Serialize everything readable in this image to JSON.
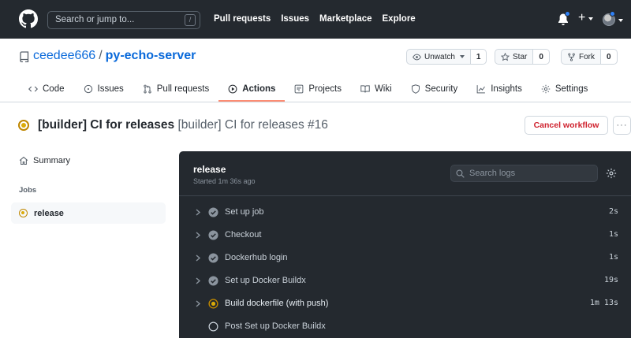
{
  "header": {
    "search_placeholder": "Search or jump to...",
    "search_shortcut": "/",
    "nav": [
      "Pull requests",
      "Issues",
      "Marketplace",
      "Explore"
    ],
    "plus": "+"
  },
  "repo": {
    "owner": "ceedee666",
    "separator": "/",
    "name": "py-echo-server",
    "actions": {
      "watch": {
        "label": "Unwatch",
        "count": "1"
      },
      "star": {
        "label": "Star",
        "count": "0"
      },
      "fork": {
        "label": "Fork",
        "count": "0"
      }
    }
  },
  "tabs": [
    {
      "label": "Code",
      "icon": "code-icon"
    },
    {
      "label": "Issues",
      "icon": "issue-icon"
    },
    {
      "label": "Pull requests",
      "icon": "pull-request-icon"
    },
    {
      "label": "Actions",
      "icon": "play-icon",
      "active": true
    },
    {
      "label": "Projects",
      "icon": "project-icon"
    },
    {
      "label": "Wiki",
      "icon": "book-icon"
    },
    {
      "label": "Security",
      "icon": "shield-icon"
    },
    {
      "label": "Insights",
      "icon": "graph-icon"
    },
    {
      "label": "Settings",
      "icon": "gear-icon"
    }
  ],
  "run": {
    "workflow": "[builder] CI for releases",
    "subtitle": "[builder] CI for releases #16",
    "cancel_label": "Cancel workflow",
    "more_label": "···"
  },
  "sidebar": {
    "summary_label": "Summary",
    "jobs_label": "Jobs",
    "job": "release"
  },
  "log": {
    "job_name": "release",
    "started": "Started 1m 36s ago",
    "search_placeholder": "Search logs",
    "steps": [
      {
        "name": "Set up job",
        "time": "2s",
        "status": "success"
      },
      {
        "name": "Checkout",
        "time": "1s",
        "status": "success"
      },
      {
        "name": "Dockerhub login",
        "time": "1s",
        "status": "success"
      },
      {
        "name": "Set up Docker Buildx",
        "time": "19s",
        "status": "success"
      },
      {
        "name": "Build dockerfile (with push)",
        "time": "1m 13s",
        "status": "in_progress"
      },
      {
        "name": "Post Set up Docker Buildx",
        "time": "",
        "status": "pending"
      }
    ]
  },
  "colors": {
    "header_bg": "#24292f",
    "log_bg": "#24292f",
    "link": "#0969da",
    "danger": "#cf222e",
    "in_progress": "#dbab09",
    "active_tab": "#fd8c73"
  }
}
